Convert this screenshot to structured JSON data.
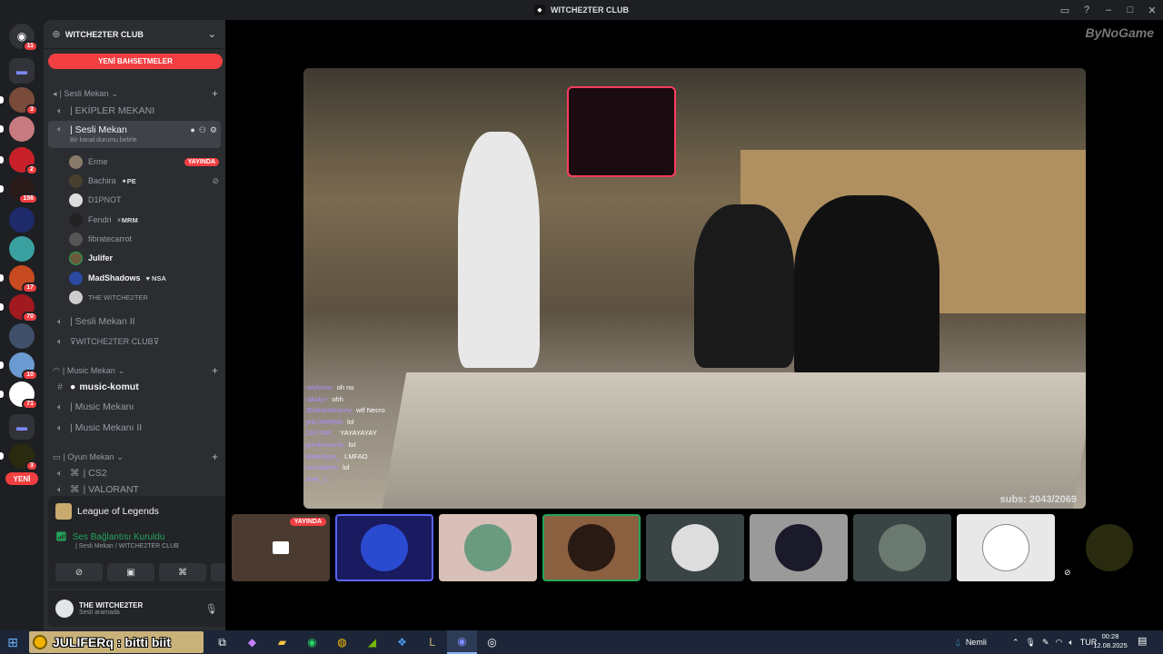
{
  "window": {
    "title": "WITCHE2TER CLUB"
  },
  "titlebar_icons": [
    "inbox-icon",
    "help-icon",
    "minimize-icon",
    "maximize-icon",
    "close-icon"
  ],
  "rail": {
    "badges": [
      "11",
      "3",
      "2",
      "156",
      "17",
      "70",
      "10",
      "71",
      "3"
    ],
    "new_label": "YENİ"
  },
  "server": {
    "name": "WITCHE2TER CLUB",
    "new_mentions": "YENİ BAHSETMELER"
  },
  "categories": {
    "sesli": "| Sesli Mekan",
    "music": "| Music Mekan",
    "oyun": "| Oyun Mekan"
  },
  "channels": {
    "ekipler": "| EKİPLER MEKANI",
    "sesli_mekan": "| Sesli Mekan",
    "sesli_mekan_status": "Bir kanal durumu belirle",
    "sesli_mekan_2": "| Sesli Mekan II",
    "witch_club": "⊽WITCHE2TER CLUB⊽",
    "music_komut": "music-komut",
    "music_mekani": "| Music Mekanı",
    "music_mekani_2": "| Music Mekanı II",
    "cs2": "| CS2",
    "valorant": "| VALORANT"
  },
  "voice_users": [
    {
      "name": "Erme",
      "tag": "",
      "live": "YAYINDA"
    },
    {
      "name": "Bachira",
      "tag": "✦PE",
      "live": ""
    },
    {
      "name": "D1PNOT",
      "tag": "",
      "live": ""
    },
    {
      "name": "Fendri",
      "tag": "⚡MRM",
      "live": ""
    },
    {
      "name": "fibratecarrot",
      "tag": "",
      "live": ""
    },
    {
      "name": "Julifer",
      "tag": "",
      "live": ""
    },
    {
      "name": "MadShadows",
      "tag": "♥ NSA",
      "live": ""
    },
    {
      "name": "THE WITCHE2TER",
      "tag": "",
      "live": ""
    }
  ],
  "activity": {
    "game": "League of Legends"
  },
  "voice_panel": {
    "status": "Ses Bağlantısı Kuruldu",
    "location": "| Sesli Mekan / WITCHE2TER CLUB"
  },
  "user": {
    "name": "THE WITCHE2TER",
    "status": "Sesli aramada"
  },
  "stream": {
    "watermark": "ByNoGame",
    "subs": "subs: 2043/2069",
    "chat": [
      {
        "user": "raisherar:",
        "msg": "oh no"
      },
      {
        "user": "rakalyn:",
        "msg": "ohh"
      },
      {
        "user": "JBallsMahoney:",
        "msg": "wtf Necro"
      },
      {
        "user": "yhk2699999:",
        "msg": "lol"
      },
      {
        "user": "ZASTAR_:",
        "msg": "YAYAYAYAY"
      },
      {
        "user": "gumbaloonly:",
        "msg": "lol"
      },
      {
        "user": "Watertype_:",
        "msg": "LMFAO"
      },
      {
        "user": "cerrobohm:",
        "msg": "lol"
      },
      {
        "user": "Arek_1:",
        "msg": ""
      }
    ]
  },
  "strip": {
    "live_label": "YAYINDA"
  },
  "taskbar": {
    "notification": "JULIFERq : bitti biit",
    "weather": "Nemli",
    "lang": "TUR",
    "time": "00:28",
    "date": "12.08.2025"
  }
}
